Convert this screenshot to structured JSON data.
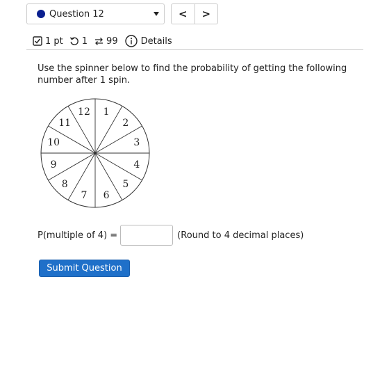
{
  "question_selector": {
    "label": "Question 12",
    "status_color": "#0a1f8f"
  },
  "nav": {
    "prev": "<",
    "next": ">"
  },
  "meta": {
    "points": "1 pt",
    "retries": "1",
    "submissions": "99",
    "details": "Details"
  },
  "prompt": "Use the spinner below to find the probability of getting the following number after 1 spin.",
  "spinner": {
    "numbers": [
      "1",
      "2",
      "3",
      "4",
      "5",
      "6",
      "7",
      "8",
      "9",
      "10",
      "11",
      "12"
    ]
  },
  "answer": {
    "label": "P(multiple of 4) =",
    "value": "",
    "hint": "(Round to 4 decimal places)"
  },
  "submit_label": "Submit Question",
  "colors": {
    "accent": "#1f70c9"
  }
}
